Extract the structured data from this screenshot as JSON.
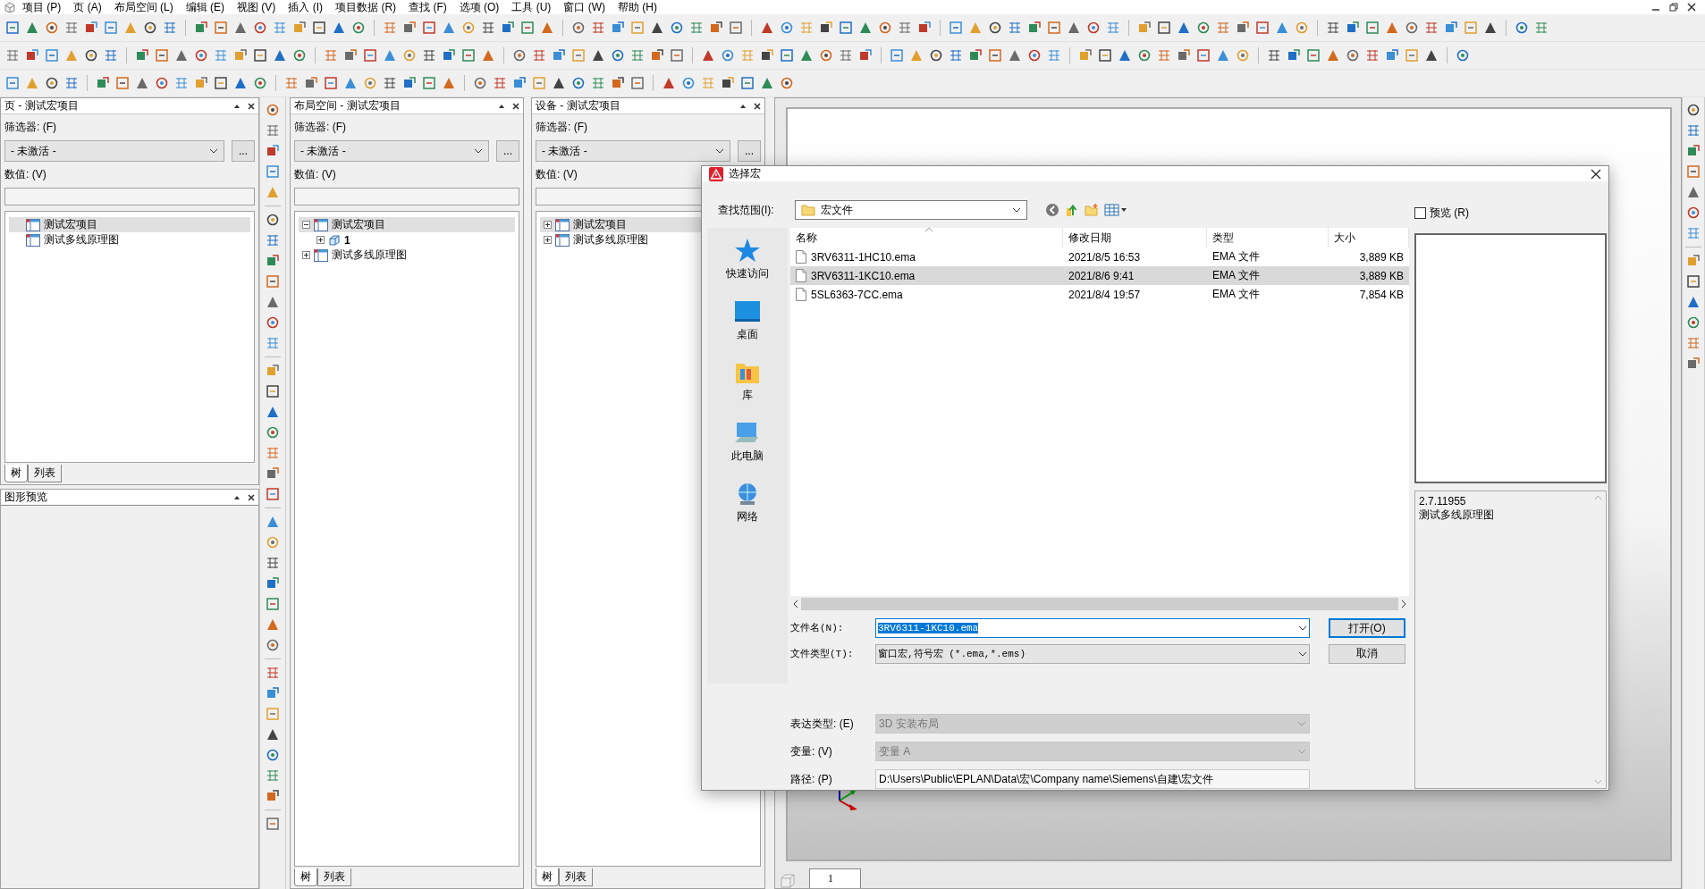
{
  "menu": [
    {
      "label": "项目 (P)"
    },
    {
      "label": "页 (A)"
    },
    {
      "label": "布局空间 (L)"
    },
    {
      "label": "编辑 (E)"
    },
    {
      "label": "视图 (V)"
    },
    {
      "label": "插入 (I)"
    },
    {
      "label": "项目数据 (R)"
    },
    {
      "label": "查找 (F)"
    },
    {
      "label": "选项 (O)"
    },
    {
      "label": "工具 (U)"
    },
    {
      "label": "窗口 (W)"
    },
    {
      "label": "帮助 (H)"
    }
  ],
  "panels": [
    {
      "title": "页 - 测试宏项目",
      "filter_label": "筛选器: (F)",
      "filter_value": "- 未激活 -",
      "more_button": "...",
      "value_label": "数值: (V)",
      "tree": [
        {
          "label": "测试宏项目",
          "kind": "page",
          "selected": true
        },
        {
          "label": "测试多线原理图",
          "kind": "page",
          "selected": false
        }
      ],
      "tabs": [
        {
          "label": "树",
          "selected": true
        },
        {
          "label": "列表",
          "selected": false
        }
      ]
    },
    {
      "title": "布局空间 - 测试宏项目",
      "filter_label": "筛选器: (F)",
      "filter_value": "- 未激活 -",
      "more_button": "...",
      "value_label": "数值: (V)",
      "tree": [
        {
          "label": "测试宏项目",
          "kind": "page",
          "selected": true,
          "expanded": true,
          "children": [
            {
              "label": "1",
              "kind": "layout",
              "selected": false,
              "expanded": false
            }
          ]
        },
        {
          "label": "测试多线原理图",
          "kind": "page",
          "selected": false,
          "expanded": false
        }
      ],
      "tabs": [
        {
          "label": "树",
          "selected": true
        },
        {
          "label": "列表",
          "selected": false
        }
      ]
    },
    {
      "title": "设备 - 测试宏项目",
      "filter_label": "筛选器: (F)",
      "filter_value": "- 未激活 -",
      "more_button": "...",
      "value_label": "数值: (V)",
      "tree": [
        {
          "label": "测试宏项目",
          "kind": "page",
          "selected": true,
          "expanded": false
        },
        {
          "label": "测试多线原理图",
          "kind": "page",
          "selected": false,
          "expanded": false
        }
      ],
      "tabs": [
        {
          "label": "树",
          "selected": true
        },
        {
          "label": "列表",
          "selected": false
        }
      ]
    }
  ],
  "preview_panel": {
    "title": "图形预览"
  },
  "canvas": {
    "tabs": [
      {
        "label": "1",
        "selected": true
      }
    ]
  },
  "dialog": {
    "title": "选择宏",
    "look_in_label": "查找范围(I):",
    "look_in_value": "宏文件",
    "places": [
      {
        "label": "快速访问",
        "kind": "star"
      },
      {
        "label": "桌面",
        "kind": "desktop"
      },
      {
        "label": "库",
        "kind": "library"
      },
      {
        "label": "此电脑",
        "kind": "computer"
      },
      {
        "label": "网络",
        "kind": "network"
      }
    ],
    "columns": [
      "名称",
      "修改日期",
      "类型",
      "大小"
    ],
    "rows": [
      {
        "cells": [
          "3RV6311-1HC10.ema",
          "2021/8/5 16:53",
          "EMA 文件",
          "3,889 KB"
        ],
        "selected": false
      },
      {
        "cells": [
          "3RV6311-1KC10.ema",
          "2021/8/6 9:41",
          "EMA 文件",
          "3,889 KB"
        ],
        "selected": true
      },
      {
        "cells": [
          "5SL6363-7CC.ema",
          "2021/8/4 19:57",
          "EMA 文件",
          "7,854 KB"
        ],
        "selected": false
      }
    ],
    "file_name_label": "文件名(N):",
    "file_name_value": "3RV6311-1KC10.ema",
    "file_name_highlighted": true,
    "file_type_label": "文件类型(T):",
    "file_type_value": "窗口宏,符号宏 (*.ema,*.ems)",
    "open_button": "打开(O)",
    "cancel_button": "取消",
    "fields": [
      {
        "label": "表达类型: (E)",
        "value": "3D 安装布局",
        "disabled": true
      },
      {
        "label": "变量: (V)",
        "value": "变量 A",
        "disabled": true
      },
      {
        "label": "路径: (P)",
        "value": "D:\\Users\\Public\\EPLAN\\Data\\宏\\Company name\\Siemens\\自建\\宏文件",
        "kind": "text",
        "disabled": false
      }
    ],
    "preview_checkbox": {
      "label": "预览 (R)",
      "checked": false
    },
    "preview_info": [
      "2.7.11955",
      "测试多线原理图"
    ]
  }
}
